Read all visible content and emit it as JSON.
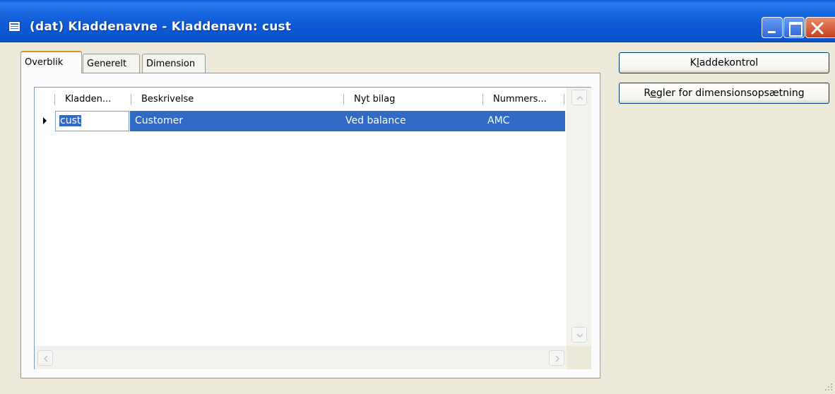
{
  "window": {
    "title": "(dat) Kladdenavne - Kladdenavn: cust",
    "icon": "form-icon"
  },
  "tabs": [
    {
      "label": "Overblik",
      "active": true
    },
    {
      "label": "Generelt",
      "active": false
    },
    {
      "label": "Dimension",
      "active": false
    }
  ],
  "grid": {
    "columns": [
      "Kladden...",
      "Beskrivelse",
      "Nyt bilag",
      "Nummers..."
    ],
    "rows": [
      {
        "name": "cust",
        "description": "Customer",
        "new_voucher": "Ved balance",
        "number_sequence": "AMC",
        "selected": true
      }
    ]
  },
  "buttons": {
    "kladdekontrol": {
      "pre": "K",
      "accel": "l",
      "post": "addekontrol"
    },
    "regler": {
      "pre": "R",
      "accel": "e",
      "post": "gler for dimensionsopsætning"
    }
  },
  "colors": {
    "titlebar": "#0a5bd6",
    "selection": "#316ac5",
    "window_bg": "#ece9d8",
    "active_tab_accent": "#e68b2c"
  }
}
